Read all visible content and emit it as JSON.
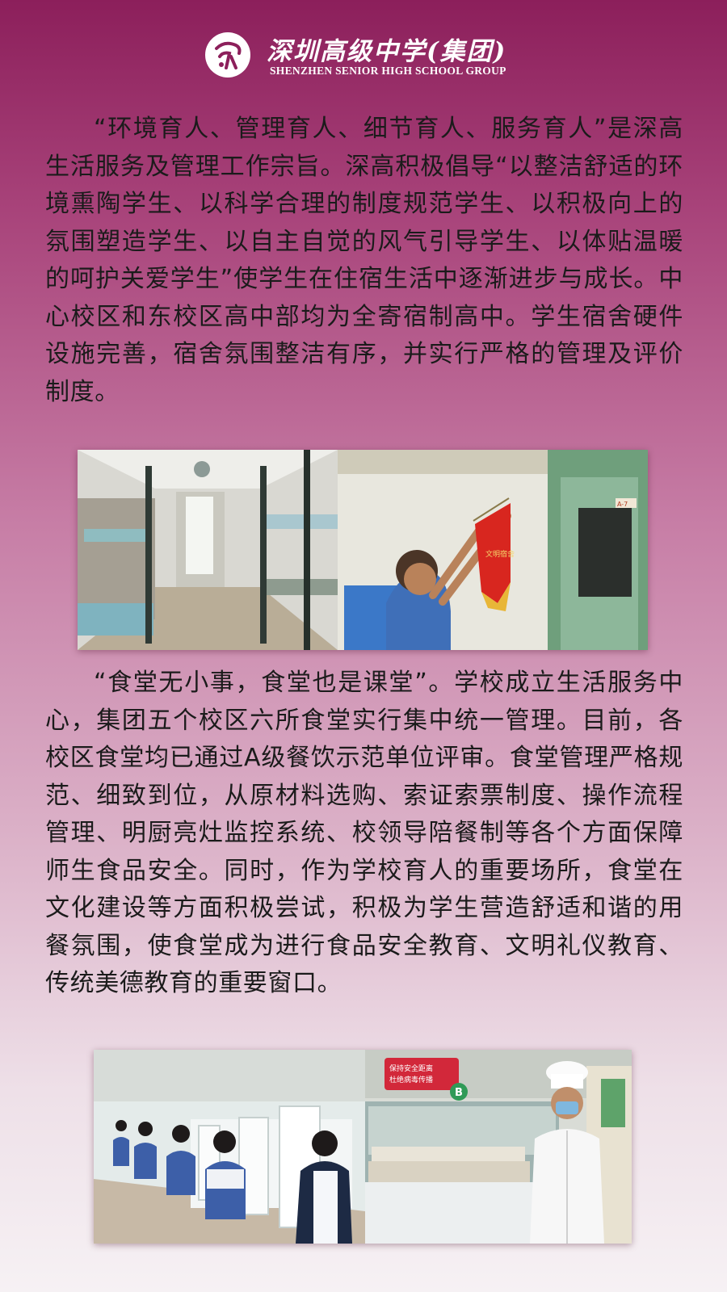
{
  "header": {
    "logo_name": "school-emblem-icon",
    "title_cn": "深圳高级中学(集团)",
    "title_en": "SHENZHEN SENIOR HIGH SCHOOL GROUP"
  },
  "section_dorm": {
    "paragraph": "“环境育人、管理育人、细节育人、服务育人”是深高生活服务及管理工作宗旨。深高积极倡导“以整洁舒适的环境熏陶学生、以科学合理的制度规范学生、以积极向上的氛围塑造学生、以自主自觉的风气引导学生、以体贴温暖的呵护关爱学生”使学生在住宿生活中逐渐进步与成长。中心校区和东校区高中部均为全寄宿制高中。学生宿舍硬件设施完善，宿舍氛围整洁有序，并实行严格的管理及评价制度。",
    "photo_left": {
      "icon": "dormitory-photo",
      "door_label": ""
    },
    "photo_right": {
      "icon": "student-hanging-banner-photo",
      "banner_text": "文明宿舍",
      "room_plate": "A-7"
    }
  },
  "section_canteen": {
    "paragraph": "“食堂无小事，食堂也是课堂”。学校成立生活服务中心，集团五个校区六所食堂实行集中统一管理。目前，各校区食堂均已通过A级餐饮示范单位评审。食堂管理严格规范、细致到位，从原材料选购、索证索票制度、操作流程管理、明厨亮灶监控系统、校领导陪餐制等各个方面保障师生食品安全。同时，作为学校育人的重要场所，食堂在文化建设等方面积极尝试，积极为学生营造舒适和谐的用餐氛围，使食堂成为进行食品安全教育、文明礼仪教育、传统美德教育的重要窗口。",
    "photo_left": {
      "icon": "students-dining-photo"
    },
    "photo_right": {
      "icon": "chef-serving-window-photo",
      "sign_text_1": "保持安全距离",
      "sign_text_2": "杜绝病毒传播",
      "window_label": "B"
    }
  },
  "colors": {
    "background_top": "#8c1f5b",
    "background_bottom": "#f6f1f4",
    "text": "#1b1b1b",
    "header_text": "#ffffff"
  }
}
